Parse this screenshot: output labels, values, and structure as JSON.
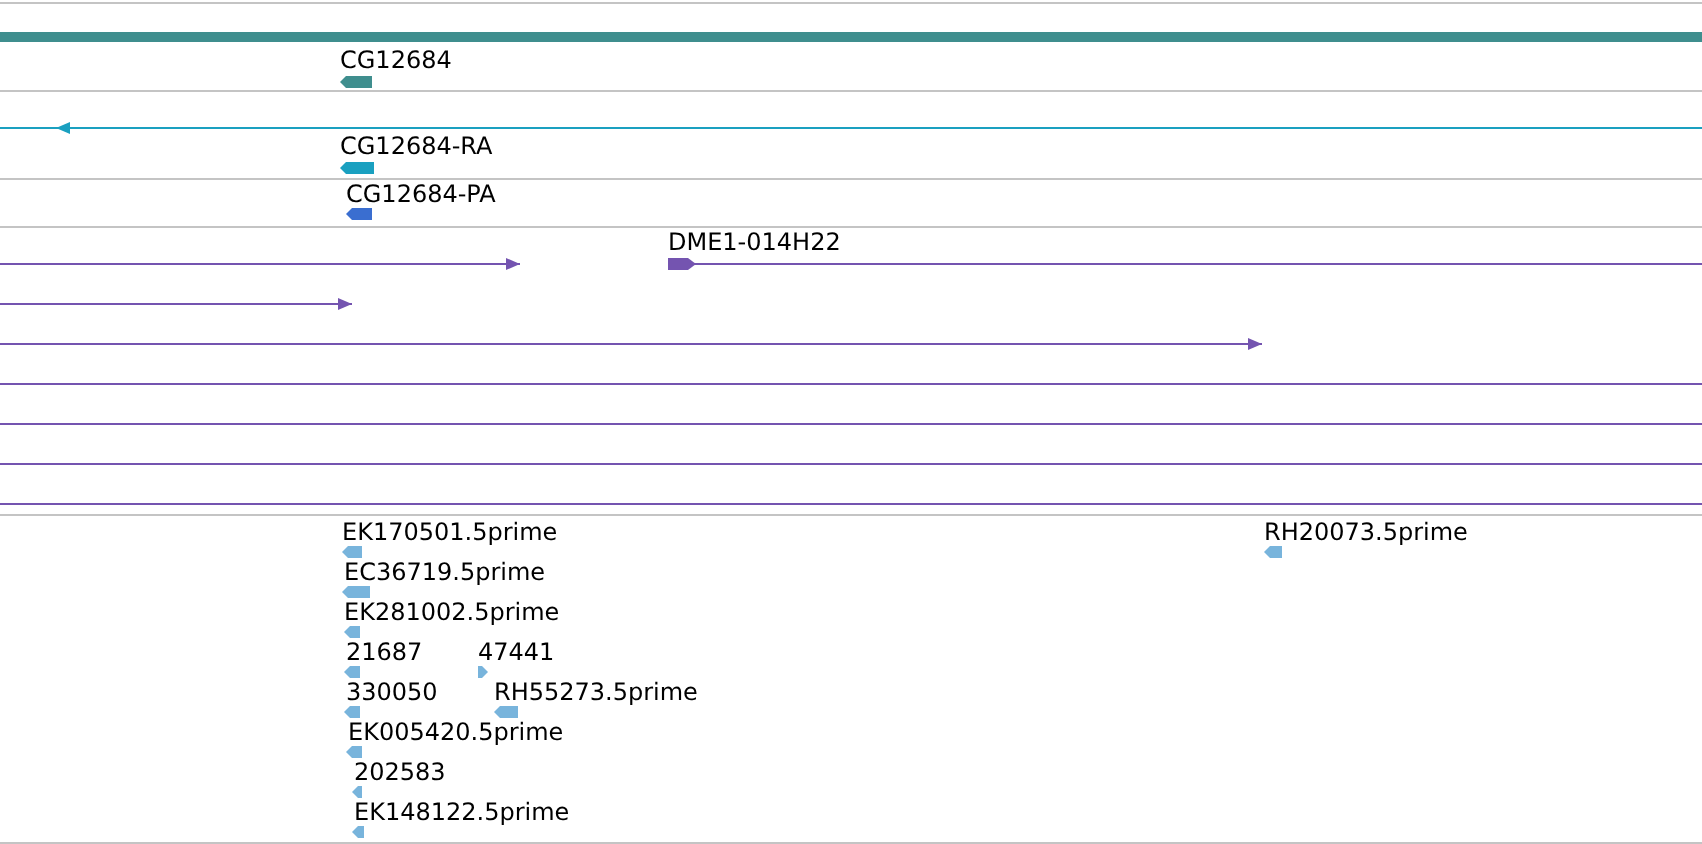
{
  "tracks": [
    {
      "kind": "gene",
      "features": [
        {
          "kind": "span"
        },
        {
          "kind": "block",
          "label": "CG12684",
          "reverse": true
        }
      ]
    },
    {
      "kind": "transcript",
      "features": [
        {
          "kind": "line",
          "reverse": true
        },
        {
          "kind": "block",
          "label": "CG12684-RA",
          "reverse": true
        }
      ]
    },
    {
      "kind": "protein",
      "features": [
        {
          "kind": "block",
          "label": "CG12684-PA",
          "reverse": true
        }
      ]
    },
    {
      "kind": "clone",
      "features": [
        {
          "kind": "line",
          "reverse": false
        },
        {
          "kind": "line",
          "label": "DME1-014H22",
          "reverse": false
        },
        {
          "kind": "line",
          "reverse": false
        },
        {
          "kind": "line",
          "reverse": false
        },
        {
          "kind": "line"
        },
        {
          "kind": "line"
        },
        {
          "kind": "line"
        },
        {
          "kind": "line"
        }
      ]
    },
    {
      "kind": "est",
      "features": [
        {
          "kind": "block",
          "label": "EK170501.5prime",
          "reverse": true
        },
        {
          "kind": "block",
          "label": "RH20073.5prime",
          "reverse": true
        },
        {
          "kind": "block",
          "label": "EC36719.5prime",
          "reverse": true
        },
        {
          "kind": "block",
          "label": "EK281002.5prime",
          "reverse": true
        },
        {
          "kind": "block",
          "label": "21687",
          "reverse": true
        },
        {
          "kind": "block",
          "label": "47441",
          "reverse": false
        },
        {
          "kind": "block",
          "label": "330050",
          "reverse": true
        },
        {
          "kind": "block",
          "label": "RH55273.5prime",
          "reverse": true
        },
        {
          "kind": "block",
          "label": "EK005420.5prime",
          "reverse": true
        },
        {
          "kind": "block",
          "label": "202583",
          "reverse": true
        },
        {
          "kind": "block",
          "label": "EK148122.5prime",
          "reverse": true
        }
      ]
    }
  ]
}
